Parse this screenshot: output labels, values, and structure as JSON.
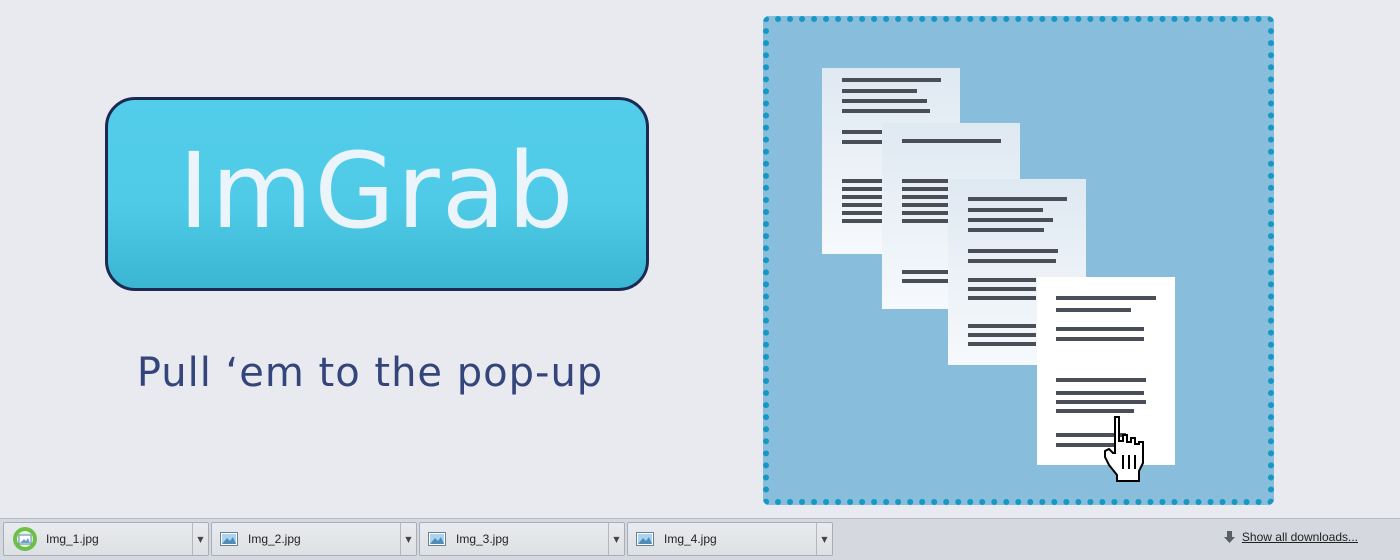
{
  "promo": {
    "logo_text": "ImGrab",
    "tagline": "Pull ‘em to the pop-up",
    "colors": {
      "background": "#e9eaef",
      "logo_fill": "#4fcbe7",
      "logo_border": "#1b2a52",
      "logo_text": "#ebf3fb",
      "tagline": "#33457a",
      "dropzone_fill": "#88bedc",
      "dropzone_border": "#1697c4"
    },
    "illustration": {
      "description_icon": "documents-drag-icon",
      "cursor_icon": "hand-pointer-icon"
    }
  },
  "download_bar": {
    "items": [
      {
        "name": "Img_1.jpg",
        "icon": "progress-image-icon"
      },
      {
        "name": "Img_2.jpg",
        "icon": "image-file-icon"
      },
      {
        "name": "Img_3.jpg",
        "icon": "image-file-icon"
      },
      {
        "name": "Img_4.jpg",
        "icon": "image-file-icon"
      }
    ],
    "dropdown_icon": "chevron-down-icon",
    "show_all_label": "Show all downloads...",
    "show_all_icon": "download-arrow-icon"
  }
}
